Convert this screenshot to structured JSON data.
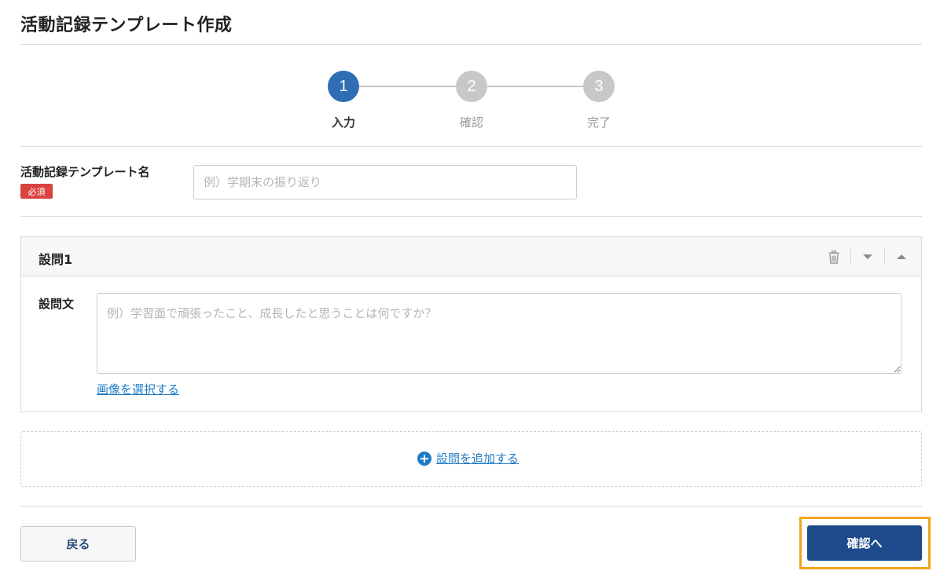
{
  "page": {
    "title": "活動記録テンプレート作成"
  },
  "stepper": {
    "steps": [
      {
        "number": "1",
        "label": "入力",
        "state": "active"
      },
      {
        "number": "2",
        "label": "確認",
        "state": "inactive"
      },
      {
        "number": "3",
        "label": "完了",
        "state": "inactive"
      }
    ]
  },
  "template_name": {
    "label": "活動記録テンプレート名",
    "required_badge": "必須",
    "placeholder": "例）学期末の振り返り",
    "value": ""
  },
  "question": {
    "title": "設問1",
    "tools": [
      "trash-icon",
      "move-down-icon",
      "move-up-icon"
    ],
    "body_label": "設問文",
    "body_placeholder": "例）学習面で頑張ったこと、成長したと思うことは何ですか？",
    "body_value": "",
    "image_link": "画像を選択する"
  },
  "add_question": {
    "label": "設問を追加する",
    "icon": "plus-circle-icon"
  },
  "footer": {
    "back_label": "戻る",
    "confirm_label": "確認へ"
  },
  "colors": {
    "accent": "#2f6db5",
    "link": "#1f7ac3",
    "required": "#d9423e",
    "primary_button": "#1d4a8a",
    "highlight": "#f0a41c",
    "inactive_step": "#c8c8c8"
  }
}
